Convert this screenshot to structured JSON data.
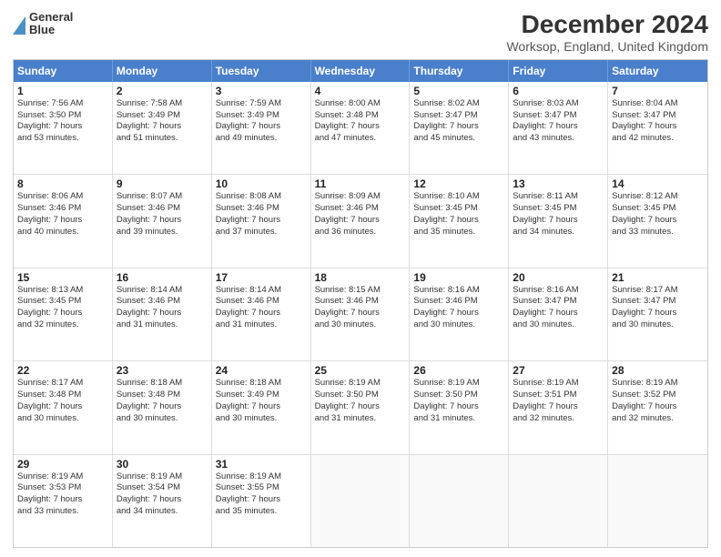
{
  "logo": {
    "line1": "General",
    "line2": "Blue"
  },
  "title": "December 2024",
  "subtitle": "Worksop, England, United Kingdom",
  "headers": [
    "Sunday",
    "Monday",
    "Tuesday",
    "Wednesday",
    "Thursday",
    "Friday",
    "Saturday"
  ],
  "weeks": [
    [
      {
        "day": "1",
        "sunrise": "7:56 AM",
        "sunset": "3:50 PM",
        "daylight": "7 hours and 53 minutes"
      },
      {
        "day": "2",
        "sunrise": "7:58 AM",
        "sunset": "3:49 PM",
        "daylight": "7 hours and 51 minutes"
      },
      {
        "day": "3",
        "sunrise": "7:59 AM",
        "sunset": "3:49 PM",
        "daylight": "7 hours and 49 minutes"
      },
      {
        "day": "4",
        "sunrise": "8:00 AM",
        "sunset": "3:48 PM",
        "daylight": "7 hours and 47 minutes"
      },
      {
        "day": "5",
        "sunrise": "8:02 AM",
        "sunset": "3:47 PM",
        "daylight": "7 hours and 45 minutes"
      },
      {
        "day": "6",
        "sunrise": "8:03 AM",
        "sunset": "3:47 PM",
        "daylight": "7 hours and 43 minutes"
      },
      {
        "day": "7",
        "sunrise": "8:04 AM",
        "sunset": "3:47 PM",
        "daylight": "7 hours and 42 minutes"
      }
    ],
    [
      {
        "day": "8",
        "sunrise": "8:06 AM",
        "sunset": "3:46 PM",
        "daylight": "7 hours and 40 minutes"
      },
      {
        "day": "9",
        "sunrise": "8:07 AM",
        "sunset": "3:46 PM",
        "daylight": "7 hours and 39 minutes"
      },
      {
        "day": "10",
        "sunrise": "8:08 AM",
        "sunset": "3:46 PM",
        "daylight": "7 hours and 37 minutes"
      },
      {
        "day": "11",
        "sunrise": "8:09 AM",
        "sunset": "3:46 PM",
        "daylight": "7 hours and 36 minutes"
      },
      {
        "day": "12",
        "sunrise": "8:10 AM",
        "sunset": "3:45 PM",
        "daylight": "7 hours and 35 minutes"
      },
      {
        "day": "13",
        "sunrise": "8:11 AM",
        "sunset": "3:45 PM",
        "daylight": "7 hours and 34 minutes"
      },
      {
        "day": "14",
        "sunrise": "8:12 AM",
        "sunset": "3:45 PM",
        "daylight": "7 hours and 33 minutes"
      }
    ],
    [
      {
        "day": "15",
        "sunrise": "8:13 AM",
        "sunset": "3:45 PM",
        "daylight": "7 hours and 32 minutes"
      },
      {
        "day": "16",
        "sunrise": "8:14 AM",
        "sunset": "3:46 PM",
        "daylight": "7 hours and 31 minutes"
      },
      {
        "day": "17",
        "sunrise": "8:14 AM",
        "sunset": "3:46 PM",
        "daylight": "7 hours and 31 minutes"
      },
      {
        "day": "18",
        "sunrise": "8:15 AM",
        "sunset": "3:46 PM",
        "daylight": "7 hours and 30 minutes"
      },
      {
        "day": "19",
        "sunrise": "8:16 AM",
        "sunset": "3:46 PM",
        "daylight": "7 hours and 30 minutes"
      },
      {
        "day": "20",
        "sunrise": "8:16 AM",
        "sunset": "3:47 PM",
        "daylight": "7 hours and 30 minutes"
      },
      {
        "day": "21",
        "sunrise": "8:17 AM",
        "sunset": "3:47 PM",
        "daylight": "7 hours and 30 minutes"
      }
    ],
    [
      {
        "day": "22",
        "sunrise": "8:17 AM",
        "sunset": "3:48 PM",
        "daylight": "7 hours and 30 minutes"
      },
      {
        "day": "23",
        "sunrise": "8:18 AM",
        "sunset": "3:48 PM",
        "daylight": "7 hours and 30 minutes"
      },
      {
        "day": "24",
        "sunrise": "8:18 AM",
        "sunset": "3:49 PM",
        "daylight": "7 hours and 30 minutes"
      },
      {
        "day": "25",
        "sunrise": "8:19 AM",
        "sunset": "3:50 PM",
        "daylight": "7 hours and 31 minutes"
      },
      {
        "day": "26",
        "sunrise": "8:19 AM",
        "sunset": "3:50 PM",
        "daylight": "7 hours and 31 minutes"
      },
      {
        "day": "27",
        "sunrise": "8:19 AM",
        "sunset": "3:51 PM",
        "daylight": "7 hours and 32 minutes"
      },
      {
        "day": "28",
        "sunrise": "8:19 AM",
        "sunset": "3:52 PM",
        "daylight": "7 hours and 32 minutes"
      }
    ],
    [
      {
        "day": "29",
        "sunrise": "8:19 AM",
        "sunset": "3:53 PM",
        "daylight": "7 hours and 33 minutes"
      },
      {
        "day": "30",
        "sunrise": "8:19 AM",
        "sunset": "3:54 PM",
        "daylight": "7 hours and 34 minutes"
      },
      {
        "day": "31",
        "sunrise": "8:19 AM",
        "sunset": "3:55 PM",
        "daylight": "7 hours and 35 minutes"
      },
      null,
      null,
      null,
      null
    ]
  ]
}
